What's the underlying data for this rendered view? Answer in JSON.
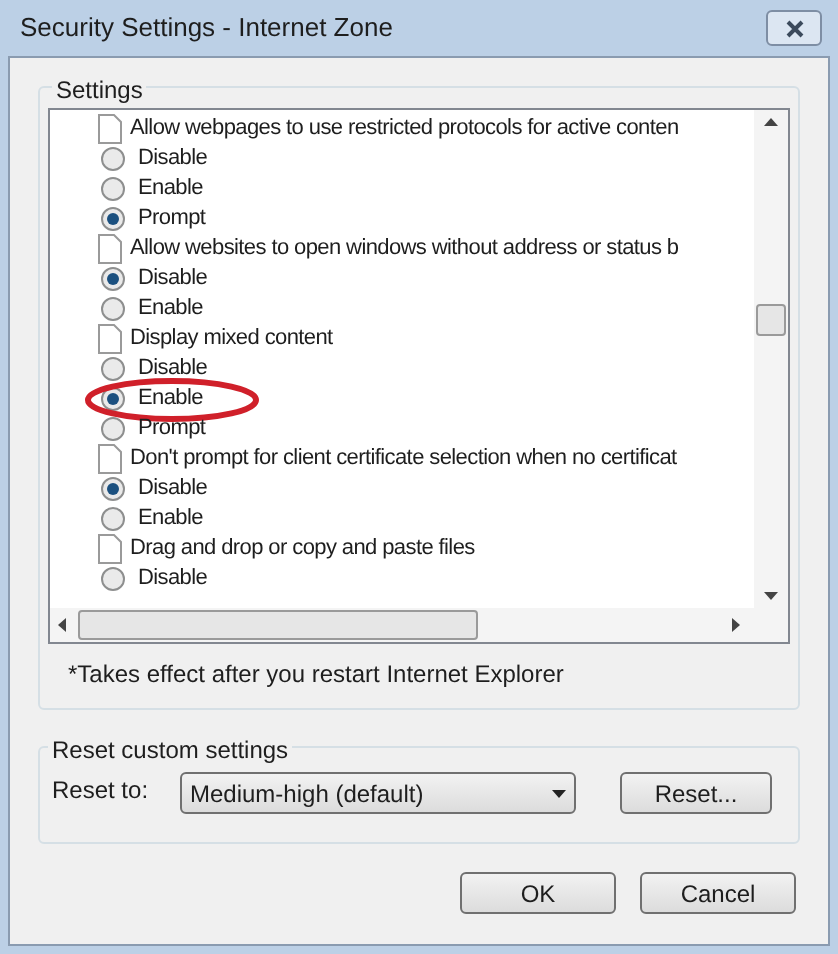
{
  "window": {
    "title": "Security Settings - Internet Zone"
  },
  "settings": {
    "label": "Settings",
    "items": [
      {
        "label": "Allow webpages to use restricted protocols for active conten",
        "options": [
          {
            "label": "Disable",
            "selected": false,
            "circled": false
          },
          {
            "label": "Enable",
            "selected": false,
            "circled": false
          },
          {
            "label": "Prompt",
            "selected": true,
            "circled": false
          }
        ]
      },
      {
        "label": "Allow websites to open windows without address or status b",
        "options": [
          {
            "label": "Disable",
            "selected": true,
            "circled": false
          },
          {
            "label": "Enable",
            "selected": false,
            "circled": false
          }
        ]
      },
      {
        "label": "Display mixed content",
        "options": [
          {
            "label": "Disable",
            "selected": false,
            "circled": false
          },
          {
            "label": "Enable",
            "selected": true,
            "circled": true
          },
          {
            "label": "Prompt",
            "selected": false,
            "circled": false
          }
        ]
      },
      {
        "label": "Don't prompt for client certificate selection when no certificat",
        "options": [
          {
            "label": "Disable",
            "selected": true,
            "circled": false
          },
          {
            "label": "Enable",
            "selected": false,
            "circled": false
          }
        ]
      },
      {
        "label": "Drag and drop or copy and paste files",
        "options": [
          {
            "label": "Disable",
            "selected": false,
            "circled": false
          }
        ]
      }
    ],
    "note": "*Takes effect after you restart Internet Explorer"
  },
  "reset": {
    "label": "Reset custom settings",
    "reset_to_label": "Reset to:",
    "dropdown": {
      "value": "Medium-high (default)"
    },
    "button": "Reset..."
  },
  "buttons": [
    "OK",
    "Cancel"
  ]
}
